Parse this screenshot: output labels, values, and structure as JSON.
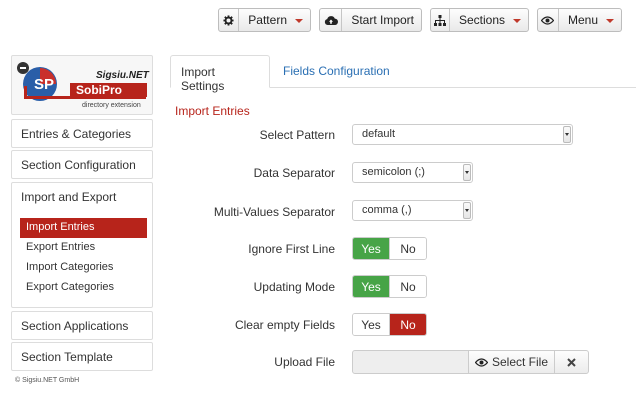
{
  "toolbar": {
    "pattern": {
      "label": "Pattern",
      "icon": "gear-icon"
    },
    "start_import": {
      "label": "Start Import",
      "icon": "cloud-upload-icon"
    },
    "sections": {
      "label": "Sections",
      "icon": "sitemap-icon"
    },
    "menu": {
      "label": "Menu",
      "icon": "eye-icon"
    }
  },
  "logo": {
    "brand_top": "Sigsiu.NET",
    "brand_main": "SobiPro",
    "brand_sub": "directory extension"
  },
  "sidebar": {
    "entries_categories": "Entries & Categories",
    "section_configuration": "Section Configuration",
    "import_export": {
      "label": "Import and Export",
      "items": [
        {
          "label": "Import Entries",
          "active": true
        },
        {
          "label": "Export Entries",
          "active": false
        },
        {
          "label": "Import Categories",
          "active": false
        },
        {
          "label": "Export Categories",
          "active": false
        }
      ]
    },
    "section_applications": "Section Applications",
    "section_template": "Section Template"
  },
  "copyright": "© Sigsiu.NET GmbH",
  "tabs": [
    {
      "label": "Import Settings",
      "active": true
    },
    {
      "label": "Fields Configuration",
      "active": false
    }
  ],
  "section_title": "Import Entries",
  "form": {
    "select_pattern": {
      "label": "Select Pattern",
      "value": "default"
    },
    "data_separator": {
      "label": "Data Separator",
      "value": "semicolon (;)"
    },
    "multi_values_separator": {
      "label": "Multi-Values Separator",
      "value": "comma (,)"
    },
    "ignore_first_line": {
      "label": "Ignore First Line",
      "yes": "Yes",
      "no": "No",
      "value": "Yes"
    },
    "updating_mode": {
      "label": "Updating Mode",
      "yes": "Yes",
      "no": "No",
      "value": "Yes"
    },
    "clear_empty_fields": {
      "label": "Clear empty Fields",
      "yes": "Yes",
      "no": "No",
      "value": "No"
    },
    "upload_file": {
      "label": "Upload File",
      "button": "Select File",
      "icon": "eye-icon",
      "clear_icon": "close-icon"
    }
  },
  "colors": {
    "accent_red": "#b7241b",
    "success_green": "#47a447",
    "link_blue": "#2a6fb3"
  }
}
